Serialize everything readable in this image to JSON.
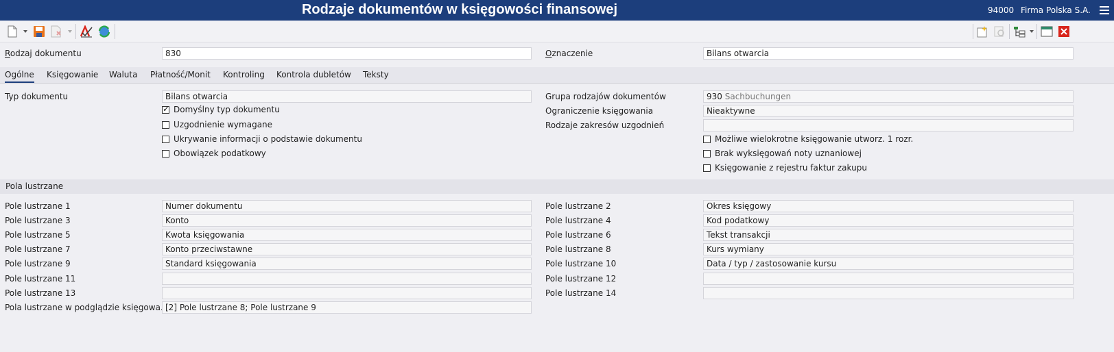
{
  "titlebar": {
    "title": "Rodzaje dokumentów w księgowości finansowej",
    "company_id": "94000",
    "company_name": "Firma Polska S.A."
  },
  "header": {
    "doc_type_label_u": "R",
    "doc_type_label_rest": "odzaj dokumentu",
    "doc_type_value": "830",
    "designation_label_u": "O",
    "designation_label_rest": "znaczenie",
    "designation_value": "Bilans otwarcia"
  },
  "tabs": [
    {
      "label": "Ogólne",
      "active": true
    },
    {
      "label": "Księgowanie"
    },
    {
      "label": "Waluta"
    },
    {
      "label": "Płatność/Monit"
    },
    {
      "label": "Kontroling"
    },
    {
      "label": "Kontrola dubletów"
    },
    {
      "label": "Teksty"
    }
  ],
  "general": {
    "typ_label": "Typ dokumentu",
    "typ_value": "Bilans otwarcia",
    "checkboxes_left": [
      {
        "label": "Domyślny typ dokumentu",
        "checked": true
      },
      {
        "label": "Uzgodnienie wymagane",
        "checked": false
      },
      {
        "label": "Ukrywanie informacji o podstawie dokumentu",
        "checked": false
      },
      {
        "label": "Obowiązek podatkowy",
        "checked": false
      }
    ],
    "group_label": "Grupa rodzajów dokumentów",
    "group_code": "930",
    "group_name": "Sachbuchungen",
    "restriction_label": "Ograniczenie księgowania",
    "restriction_value": "Nieaktywne",
    "ranges_label": "Rodzaje zakresów uzgodnień",
    "ranges_value": "",
    "checkboxes_right": [
      {
        "label": "Możliwe wielokrotne księgowanie utworz. 1 rozr.",
        "checked": false
      },
      {
        "label": "Brak wyksięgowań noty uznaniowej",
        "checked": false
      },
      {
        "label": "Księgowanie z rejestru faktur zakupu",
        "checked": false
      }
    ]
  },
  "mirror": {
    "section_title": "Pola lustrzane",
    "left": [
      {
        "label": "Pole lustrzane 1",
        "value": "Numer dokumentu"
      },
      {
        "label": "Pole lustrzane 3",
        "value": "Konto"
      },
      {
        "label": "Pole lustrzane 5",
        "value": "Kwota księgowania"
      },
      {
        "label": "Pole lustrzane 7",
        "value": "Konto przeciwstawne"
      },
      {
        "label": "Pole lustrzane 9",
        "value": "Standard księgowania"
      },
      {
        "label": "Pole lustrzane 11",
        "value": ""
      },
      {
        "label": "Pole lustrzane 13",
        "value": ""
      },
      {
        "label": "Pola lustrzane w podglądzie księgowa...",
        "value": "[2] Pole lustrzane 8; Pole lustrzane 9"
      }
    ],
    "right": [
      {
        "label": "Pole lustrzane 2",
        "value": "Okres księgowy"
      },
      {
        "label": "Pole lustrzane 4",
        "value": "Kod podatkowy"
      },
      {
        "label": "Pole lustrzane 6",
        "value": "Tekst transakcji"
      },
      {
        "label": "Pole lustrzane 8",
        "value": "Kurs wymiany"
      },
      {
        "label": "Pole lustrzane 10",
        "value": "Data / typ / zastosowanie kursu"
      },
      {
        "label": "Pole lustrzane 12",
        "value": ""
      },
      {
        "label": "Pole lustrzane 14",
        "value": ""
      }
    ]
  },
  "toolbar_icons": [
    "new-document-icon",
    "save-icon",
    "delete-icon",
    "validate-icon",
    "refresh-icon",
    "new-record-icon",
    "preview-icon",
    "tree-view-icon",
    "window-icon",
    "close-icon"
  ],
  "colors": {
    "titlebar": "#1c3e7c",
    "background": "#efeff3",
    "accent_red": "#d9261c"
  }
}
